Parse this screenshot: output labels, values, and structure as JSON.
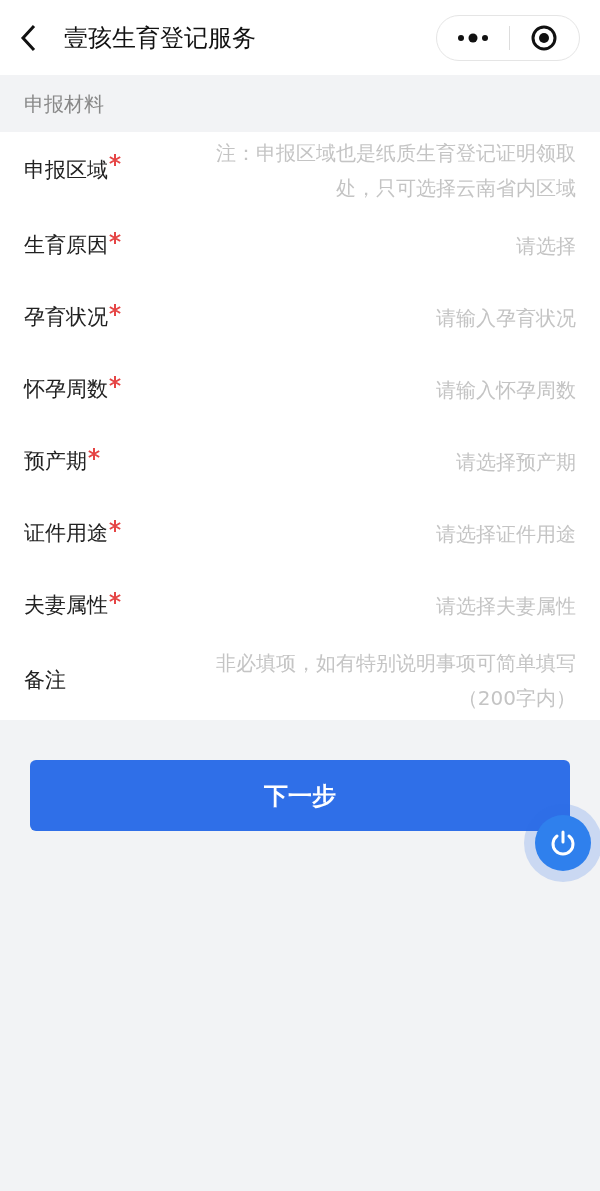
{
  "header": {
    "title": "壹孩生育登记服务"
  },
  "section": {
    "title": "申报材料"
  },
  "fields": [
    {
      "label": "申报区域",
      "required": true,
      "kind": "textarea",
      "placeholder": "注：申报区域也是纸质生育登记证明领取处，只可选择云南省内区域"
    },
    {
      "label": "生育原因",
      "required": true,
      "kind": "input",
      "placeholder": "请选择"
    },
    {
      "label": "孕育状况",
      "required": true,
      "kind": "input",
      "placeholder": "请输入孕育状况"
    },
    {
      "label": "怀孕周数",
      "required": true,
      "kind": "input",
      "placeholder": "请输入怀孕周数"
    },
    {
      "label": "预产期",
      "required": true,
      "kind": "input",
      "placeholder": "请选择预产期"
    },
    {
      "label": "证件用途",
      "required": true,
      "kind": "input",
      "placeholder": "请选择证件用途"
    },
    {
      "label": "夫妻属性",
      "required": true,
      "kind": "input",
      "placeholder": "请选择夫妻属性"
    },
    {
      "label": "备注",
      "required": false,
      "kind": "textarea",
      "placeholder": "非必填项，如有特别说明事项可简单填写（200字内）"
    }
  ],
  "next_button": "下一步"
}
